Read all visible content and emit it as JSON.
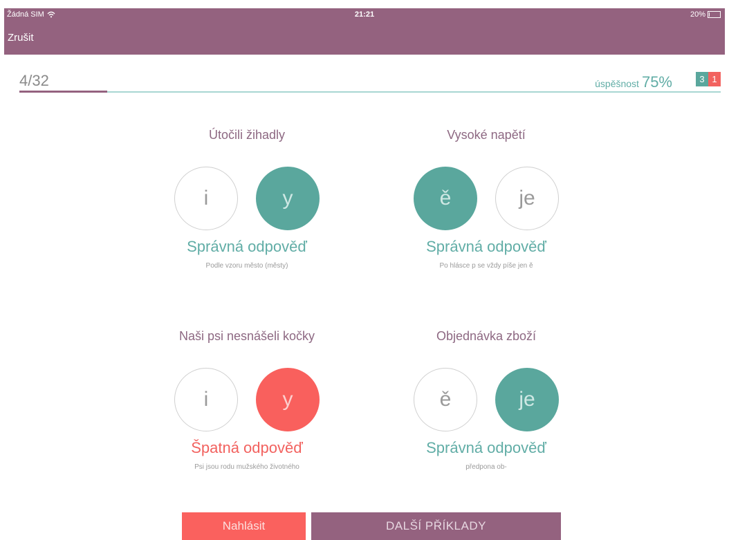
{
  "status_bar": {
    "carrier": "Žádná SIM",
    "time": "21:21",
    "battery": "20%",
    "battery_level": 0.2
  },
  "nav": {
    "cancel_label": "Zrušit"
  },
  "progress": {
    "counter": "4/32",
    "fraction": 0.125,
    "success_label": "úspěšnost",
    "success_value": "75%",
    "correct_count": "3",
    "wrong_count": "1"
  },
  "questions": [
    {
      "title": "Útočili žihadly",
      "options": [
        "i",
        "y"
      ],
      "verdict": "Správná odpověď",
      "hint": "Podle vzoru město (městy)"
    },
    {
      "title": "Vysoké napětí",
      "options": [
        "ě",
        "je"
      ],
      "verdict": "Správná odpověď",
      "hint": "Po hlásce p se vždy píše jen ě"
    },
    {
      "title": "Naši psi nesnášeli kočky",
      "options": [
        "i",
        "y"
      ],
      "verdict": "Špatná odpověď",
      "hint": "Psi jsou rodu mužského životného"
    },
    {
      "title": "Objednávka zboží",
      "options": [
        "ě",
        "je"
      ],
      "verdict": "Správná odpověď",
      "hint": "předpona ob-"
    }
  ],
  "footer": {
    "report_label": "Nahlásit",
    "next_label": "DALŠÍ PŘÍKLADY"
  },
  "colors": {
    "header": "#94627f",
    "correct": "#5aa79d",
    "wrong": "#f9605d"
  }
}
